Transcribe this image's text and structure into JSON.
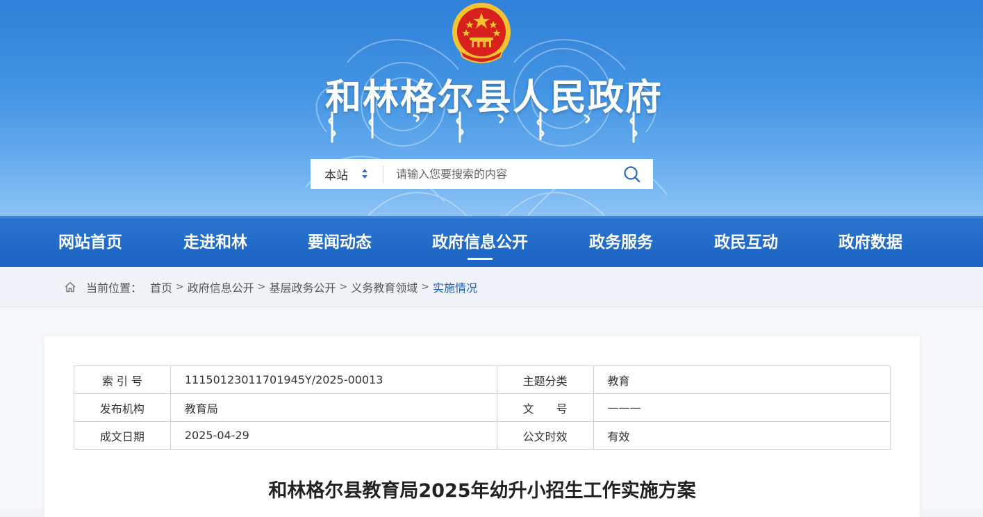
{
  "header": {
    "site_title": "和林格尔县人民政府"
  },
  "search": {
    "scope": "本站",
    "placeholder": "请输入您要搜索的内容"
  },
  "nav": {
    "items": [
      {
        "label": "网站首页"
      },
      {
        "label": "走进和林"
      },
      {
        "label": "要闻动态"
      },
      {
        "label": "政府信息公开"
      },
      {
        "label": "政务服务"
      },
      {
        "label": "政民互动"
      },
      {
        "label": "政府数据"
      }
    ],
    "active_index": 3
  },
  "breadcrumb": {
    "prefix": "当前位置：",
    "items": [
      "首页",
      "政府信息公开",
      "基层政务公开",
      "义务教育领域"
    ],
    "current": "实施情况",
    "separator": ">"
  },
  "meta": {
    "rows": [
      {
        "label1": "索 引 号",
        "value1": "11150123011701945Y/2025-00013",
        "label2": "主题分类",
        "value2": "教育"
      },
      {
        "label1": "发布机构",
        "value1": "教育局",
        "label2": "文　　号",
        "value2": "———"
      },
      {
        "label1": "成文日期",
        "value1": "2025-04-29",
        "label2": "公文时效",
        "value2": "有效"
      }
    ]
  },
  "article": {
    "title": "和林格尔县教育局2025年幼升小招生工作实施方案"
  },
  "colors": {
    "header_blue": "#2f80d8",
    "nav_blue": "#1b63c2",
    "breadcrumb_current": "#1f5fb5",
    "emblem_red": "#d8201c",
    "emblem_gold": "#f4c430"
  }
}
